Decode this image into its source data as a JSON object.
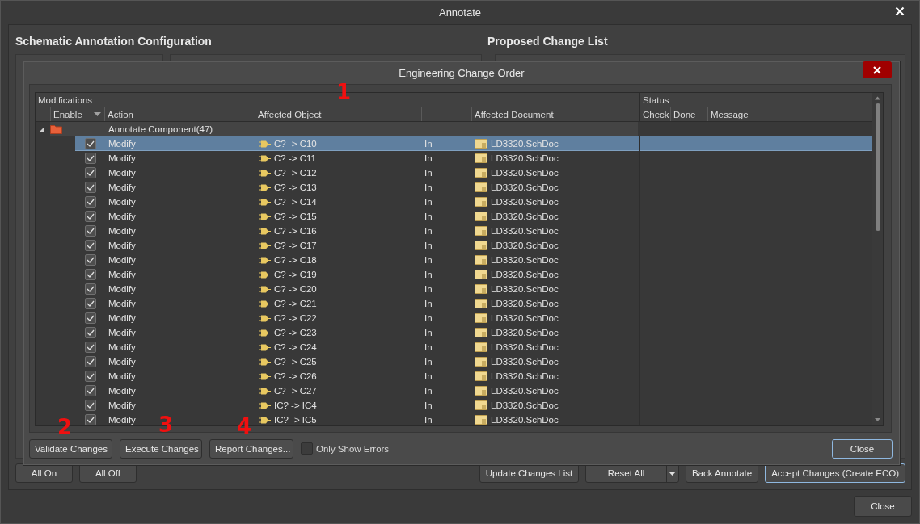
{
  "window": {
    "title": "Annotate"
  },
  "config": {
    "heading": "Schematic Annotation Configuration"
  },
  "proposed": {
    "heading": "Proposed Change List"
  },
  "left_buttons": [
    {
      "label": "All On",
      "focused": false
    },
    {
      "label": "All Off",
      "focused": false
    }
  ],
  "right_buttons": [
    {
      "label": "Update Changes List",
      "kind": "plain",
      "focused": false
    },
    {
      "label": "Reset All",
      "kind": "split",
      "focused": false
    },
    {
      "label": "Back Annotate",
      "kind": "plain",
      "focused": false
    },
    {
      "label": "Accept Changes (Create ECO)",
      "kind": "plain",
      "focused": true
    }
  ],
  "close_button": {
    "label": "Close"
  },
  "eco": {
    "title": "Engineering Change Order",
    "groups": {
      "modifications": "Modifications",
      "status": "Status"
    },
    "modification_columns": [
      "Enable",
      "Action",
      "Affected Object",
      "Affected Document"
    ],
    "status_columns": [
      "Check",
      "Done",
      "Message"
    ],
    "group": {
      "label": "Annotate Component(47)",
      "expanded": true
    },
    "rows": [
      {
        "checked": true,
        "action": "Modify",
        "object": "C? -> C10",
        "direction": "In",
        "document": "LD3320.SchDoc",
        "selected": true
      },
      {
        "checked": true,
        "action": "Modify",
        "object": "C? -> C11",
        "direction": "In",
        "document": "LD3320.SchDoc",
        "selected": false
      },
      {
        "checked": true,
        "action": "Modify",
        "object": "C? -> C12",
        "direction": "In",
        "document": "LD3320.SchDoc",
        "selected": false
      },
      {
        "checked": true,
        "action": "Modify",
        "object": "C? -> C13",
        "direction": "In",
        "document": "LD3320.SchDoc",
        "selected": false
      },
      {
        "checked": true,
        "action": "Modify",
        "object": "C? -> C14",
        "direction": "In",
        "document": "LD3320.SchDoc",
        "selected": false
      },
      {
        "checked": true,
        "action": "Modify",
        "object": "C? -> C15",
        "direction": "In",
        "document": "LD3320.SchDoc",
        "selected": false
      },
      {
        "checked": true,
        "action": "Modify",
        "object": "C? -> C16",
        "direction": "In",
        "document": "LD3320.SchDoc",
        "selected": false
      },
      {
        "checked": true,
        "action": "Modify",
        "object": "C? -> C17",
        "direction": "In",
        "document": "LD3320.SchDoc",
        "selected": false
      },
      {
        "checked": true,
        "action": "Modify",
        "object": "C? -> C18",
        "direction": "In",
        "document": "LD3320.SchDoc",
        "selected": false
      },
      {
        "checked": true,
        "action": "Modify",
        "object": "C? -> C19",
        "direction": "In",
        "document": "LD3320.SchDoc",
        "selected": false
      },
      {
        "checked": true,
        "action": "Modify",
        "object": "C? -> C20",
        "direction": "In",
        "document": "LD3320.SchDoc",
        "selected": false
      },
      {
        "checked": true,
        "action": "Modify",
        "object": "C? -> C21",
        "direction": "In",
        "document": "LD3320.SchDoc",
        "selected": false
      },
      {
        "checked": true,
        "action": "Modify",
        "object": "C? -> C22",
        "direction": "In",
        "document": "LD3320.SchDoc",
        "selected": false
      },
      {
        "checked": true,
        "action": "Modify",
        "object": "C? -> C23",
        "direction": "In",
        "document": "LD3320.SchDoc",
        "selected": false
      },
      {
        "checked": true,
        "action": "Modify",
        "object": "C? -> C24",
        "direction": "In",
        "document": "LD3320.SchDoc",
        "selected": false
      },
      {
        "checked": true,
        "action": "Modify",
        "object": "C? -> C25",
        "direction": "In",
        "document": "LD3320.SchDoc",
        "selected": false
      },
      {
        "checked": true,
        "action": "Modify",
        "object": "C? -> C26",
        "direction": "In",
        "document": "LD3320.SchDoc",
        "selected": false
      },
      {
        "checked": true,
        "action": "Modify",
        "object": "C? -> C27",
        "direction": "In",
        "document": "LD3320.SchDoc",
        "selected": false
      },
      {
        "checked": true,
        "action": "Modify",
        "object": "IC? -> IC4",
        "direction": "In",
        "document": "LD3320.SchDoc",
        "selected": false
      },
      {
        "checked": true,
        "action": "Modify",
        "object": "IC? -> IC5",
        "direction": "In",
        "document": "LD3320.SchDoc",
        "selected": false
      }
    ],
    "buttons": [
      {
        "label": "Validate Changes"
      },
      {
        "label": "Execute Changes"
      },
      {
        "label": "Report Changes..."
      }
    ],
    "only_show_errors": {
      "label": "Only Show Errors",
      "checked": false
    },
    "close": {
      "label": "Close"
    }
  },
  "markers": [
    {
      "text": "1"
    },
    {
      "text": "2"
    },
    {
      "text": "3"
    },
    {
      "text": "4"
    }
  ]
}
